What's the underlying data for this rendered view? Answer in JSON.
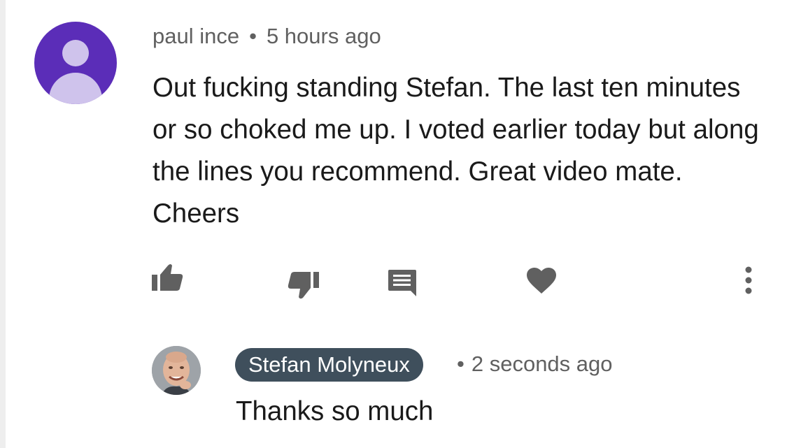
{
  "comment": {
    "author": "paul ince",
    "separator": "•",
    "time": "5 hours ago",
    "text": "Out fucking standing Stefan. The last ten minutes or so choked me up. I voted earlier today but along the lines you recommend. Great video mate. Cheers",
    "avatar_color": "#5b2db8",
    "actions": [
      "thumb-up-icon",
      "thumb-down-icon",
      "reply-icon",
      "heart-icon",
      "more-vert-icon"
    ]
  },
  "reply": {
    "author": "Stefan Molyneux",
    "separator": "•",
    "time": "2 seconds ago",
    "text": "Thanks so much",
    "badge_color": "#3f4f5c"
  },
  "colors": {
    "icon": "#606060",
    "meta_text": "#606060",
    "body_text": "#1a1a1a"
  }
}
